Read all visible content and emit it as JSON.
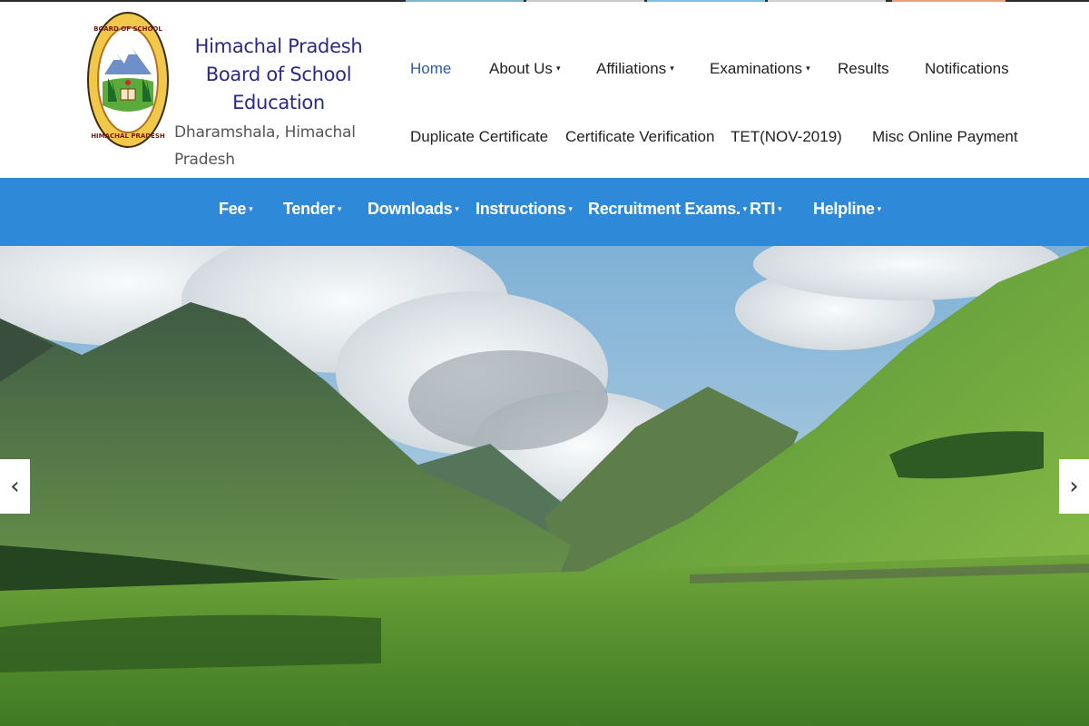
{
  "brand": {
    "line1": "Himachal Pradesh",
    "line2": "Board of School Education",
    "line3": "Dharamshala, Himachal Pradesh"
  },
  "top_nav": {
    "row1": [
      {
        "label": "Home",
        "caret": false,
        "active": true
      },
      {
        "label": "About Us",
        "caret": true
      },
      {
        "label": "Affiliations",
        "caret": true
      },
      {
        "label": "Examinations",
        "caret": true
      },
      {
        "label": "Results",
        "caret": false
      },
      {
        "label": "Notifications",
        "caret": false
      }
    ],
    "row2": [
      {
        "label": "Duplicate Certificate"
      },
      {
        "label": "Certificate Verification"
      },
      {
        "label": "TET(NOV-2019)"
      },
      {
        "label": "Misc Online Payment"
      }
    ]
  },
  "menu_bar": {
    "items": [
      {
        "label": "Fee"
      },
      {
        "label": "Tender"
      },
      {
        "label": "Downloads"
      },
      {
        "label": "Instructions"
      },
      {
        "label": "Recruitment Exams."
      },
      {
        "label": "RTI"
      },
      {
        "label": "Helpline"
      }
    ]
  },
  "icons": {
    "caret": "▾",
    "prev": "‹",
    "next": "›",
    "prev_name": "chevron-left-icon",
    "next_name": "chevron-right-icon"
  },
  "colors": {
    "menu_bar": "#2e8ad8",
    "brand_text": "#2a2a86",
    "active_link": "#2e5aa8"
  }
}
